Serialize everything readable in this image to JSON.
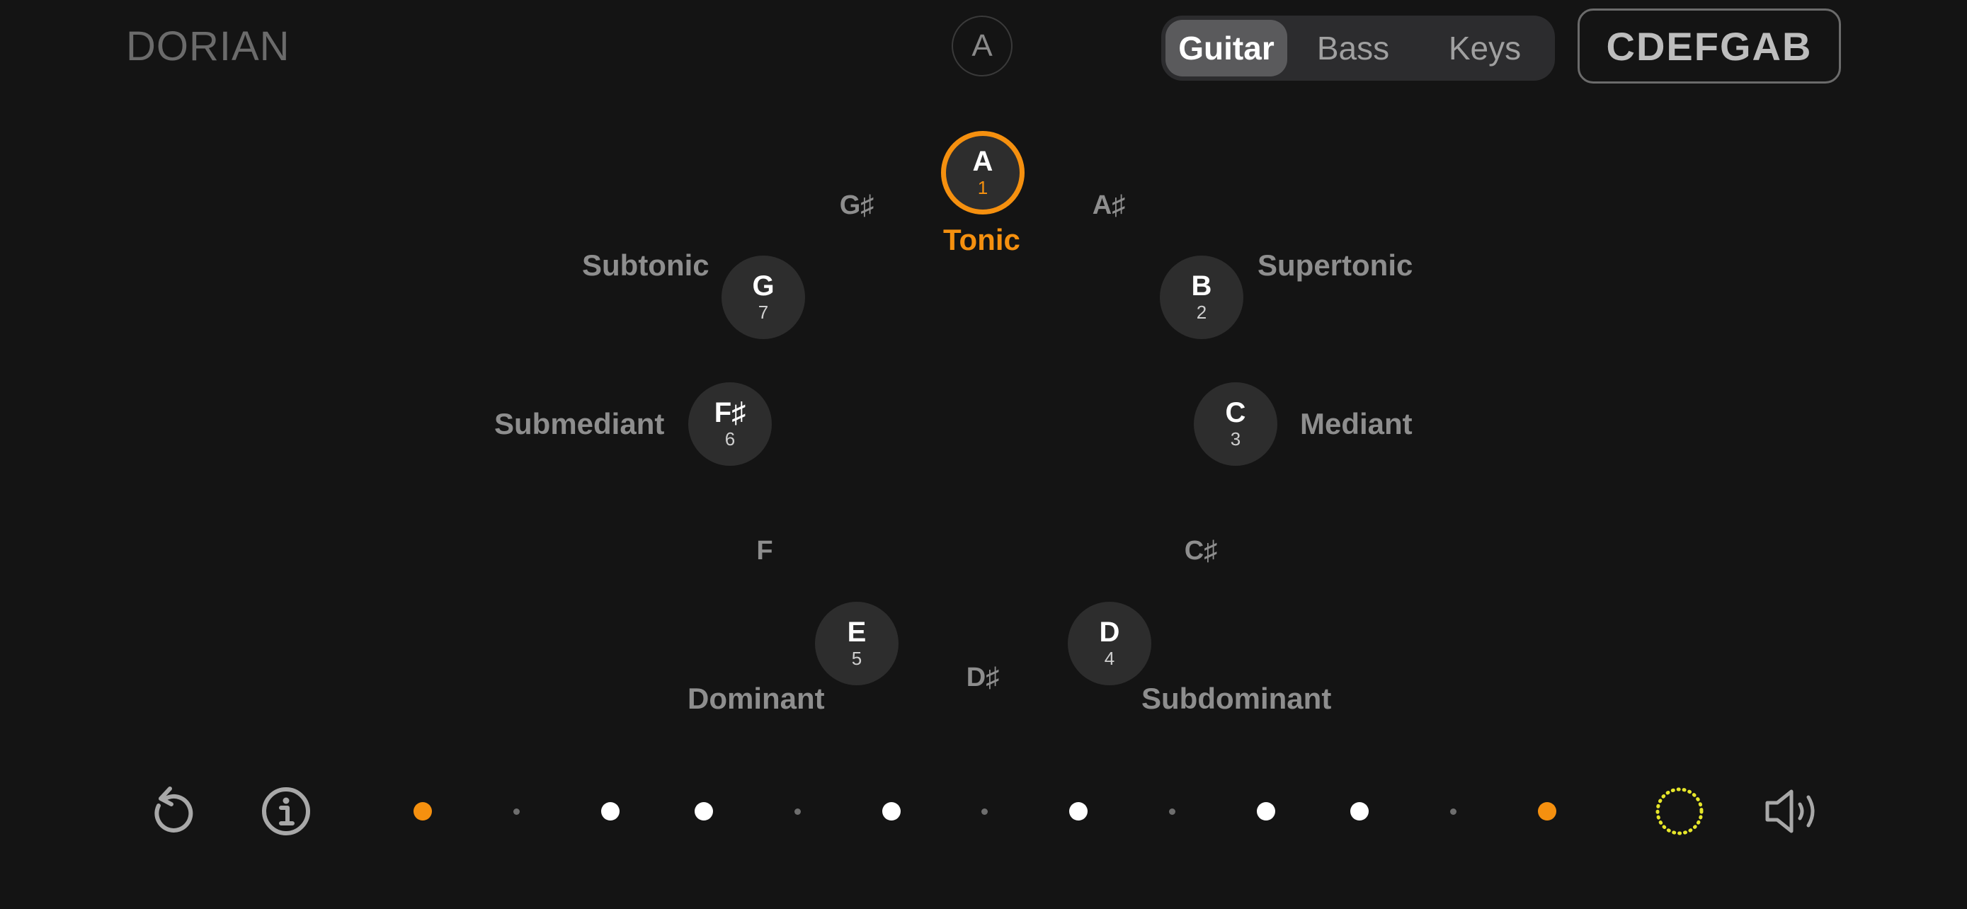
{
  "header": {
    "mode": "DORIAN",
    "root": "A",
    "instruments": [
      {
        "label": "Guitar",
        "active": true
      },
      {
        "label": "Bass",
        "active": false
      },
      {
        "label": "Keys",
        "active": false
      }
    ],
    "notes_button": "CDEFGAB"
  },
  "scale": {
    "tonic": {
      "note": "A",
      "degree": "1",
      "function": "Tonic"
    },
    "degrees": [
      {
        "note": "B",
        "degree": "2",
        "function": "Supertonic"
      },
      {
        "note": "C",
        "degree": "3",
        "function": "Mediant"
      },
      {
        "note": "D",
        "degree": "4",
        "function": "Subdominant"
      },
      {
        "note": "E",
        "degree": "5",
        "function": "Dominant"
      },
      {
        "note": "F♯",
        "degree": "6",
        "function": "Submediant"
      },
      {
        "note": "G",
        "degree": "7",
        "function": "Subtonic"
      }
    ],
    "chromatic": [
      "A♯",
      "C♯",
      "D♯",
      "F",
      "G♯"
    ]
  },
  "step_indicator": {
    "colors": {
      "root": "#f5900f",
      "scale": "#ffffff",
      "off": "#6e6e6e"
    },
    "steps": [
      "root",
      "off",
      "scale",
      "scale",
      "off",
      "scale",
      "off",
      "scale",
      "off",
      "scale",
      "scale",
      "off",
      "root"
    ]
  },
  "toolbar": {
    "reset_icon": "reset-icon",
    "info_icon": "info-icon",
    "loop_icon": "dotted-circle-icon",
    "sound_icon": "speaker-icon"
  },
  "colors": {
    "accent": "#f5900f",
    "loop": "#e6e62a",
    "background": "#141414"
  }
}
